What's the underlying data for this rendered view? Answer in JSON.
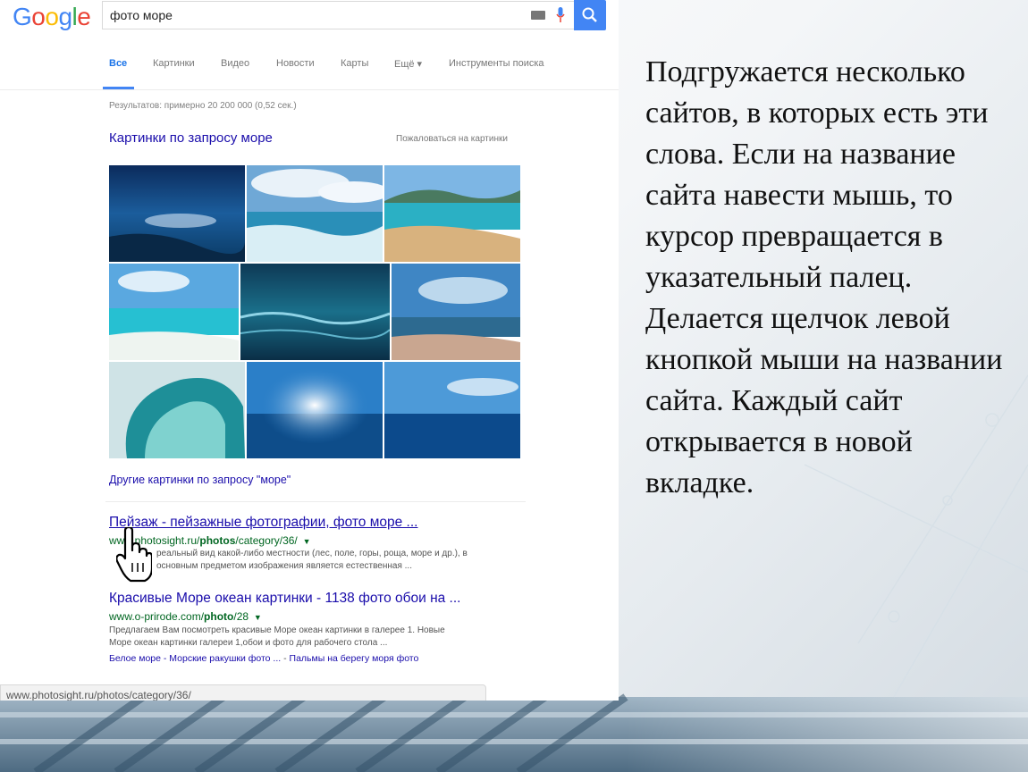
{
  "google": {
    "logo_letters": [
      {
        "ch": "G",
        "color": "#4285f4"
      },
      {
        "ch": "o",
        "color": "#ea4335"
      },
      {
        "ch": "o",
        "color": "#fbbc05"
      },
      {
        "ch": "g",
        "color": "#4285f4"
      },
      {
        "ch": "l",
        "color": "#34a853"
      },
      {
        "ch": "e",
        "color": "#ea4335"
      }
    ],
    "search_query": "фото море",
    "icons": [
      "keyboard-icon",
      "microphone-icon",
      "search-icon"
    ]
  },
  "tabs": [
    {
      "label": "Все",
      "active": true
    },
    {
      "label": "Картинки"
    },
    {
      "label": "Видео"
    },
    {
      "label": "Новости"
    },
    {
      "label": "Карты"
    },
    {
      "label": "Ещё ▾"
    },
    {
      "label": "Инструменты поиска"
    }
  ],
  "results_count": "Результатов: примерно 20 200 000 (0,52 сек.)",
  "images_block": {
    "heading": "Картинки по запросу море",
    "complain": "Пожаловаться на картинки",
    "more_link": "Другие картинки по запросу \"море\""
  },
  "results": [
    {
      "title": "Пейзаж - пейзажные фотографии, фото море ...",
      "url_prefix": "www.",
      "url_domain": "photosight.ru/",
      "url_bold": "photos",
      "url_rest": "/category/36/",
      "snippet_line1": "реальный вид какой-либо местности (лес, поле, горы, роща, море и др.), в",
      "snippet_line2": "основным предметом изображения является естественная ..."
    },
    {
      "title": "Красивые Море океан картинки - 1138 фото обои на ...",
      "url_domain": "www.o-prirode.com/",
      "url_bold": "photo",
      "url_rest": "/28",
      "snippet_line1": "Предлагаем Вам посмотреть красивые Море океан картинки в галерее 1. Новые",
      "snippet_line2": "Море океан картинки галереи 1,обои и фото для рабочего стола ...",
      "sitelink1": "Белое море - Морские ракушки фото ...",
      "separator": " - ",
      "sitelink2": "Пальмы на берегу моря фото"
    }
  ],
  "status_bar": "www.photosight.ru/photos/category/36/",
  "caption": "Подгружается несколько сайтов, в которых есть эти слова. Если на название сайта навести мышь, то курсор превращается в указательный палец. Делается щелчок левой кнопкой мыши на названии сайта. Каждый сайт открывается в новой вкладке."
}
